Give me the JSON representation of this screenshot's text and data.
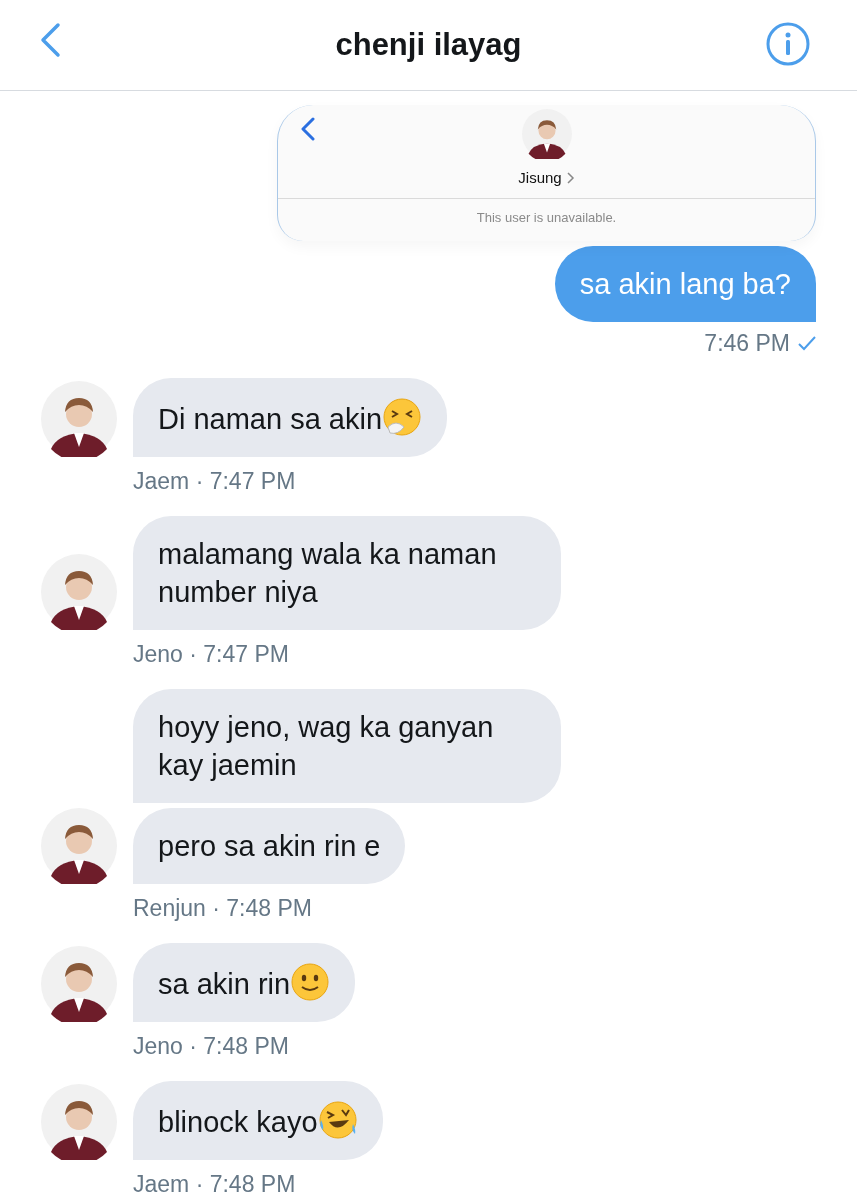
{
  "header": {
    "title": "chenji ilayag"
  },
  "shared_image": {
    "name": "Jisung",
    "status": "This user is unavailable."
  },
  "messages": [
    {
      "kind": "outgoing",
      "bubbles": [
        {
          "text": "sa akin lang ba?"
        }
      ],
      "time": "7:46 PM",
      "delivered": true
    },
    {
      "kind": "incoming",
      "meta": "Jaem · 7:47 PM",
      "bubbles": [
        {
          "text": "Di naman sa akin",
          "kind": "sneeze"
        }
      ]
    },
    {
      "kind": "incoming",
      "meta": "Jeno · 7:47 PM",
      "bubbles": [
        {
          "text": "malamang wala ka naman number niya"
        }
      ]
    },
    {
      "kind": "incoming",
      "meta": "Renjun · 7:48 PM",
      "bubbles": [
        {
          "text": "hoyy jeno, wag ka ganyan kay jaemin"
        },
        {
          "text": "pero sa akin rin e"
        }
      ]
    },
    {
      "kind": "incoming",
      "meta": "Jeno · 7:48 PM",
      "bubbles": [
        {
          "text": "sa akin rin",
          "kind": "smile"
        }
      ]
    },
    {
      "kind": "incoming",
      "meta": "Jaem · 7:48 PM",
      "bubbles": [
        {
          "text": "blinock kayo",
          "kind": "laugh"
        }
      ]
    }
  ]
}
